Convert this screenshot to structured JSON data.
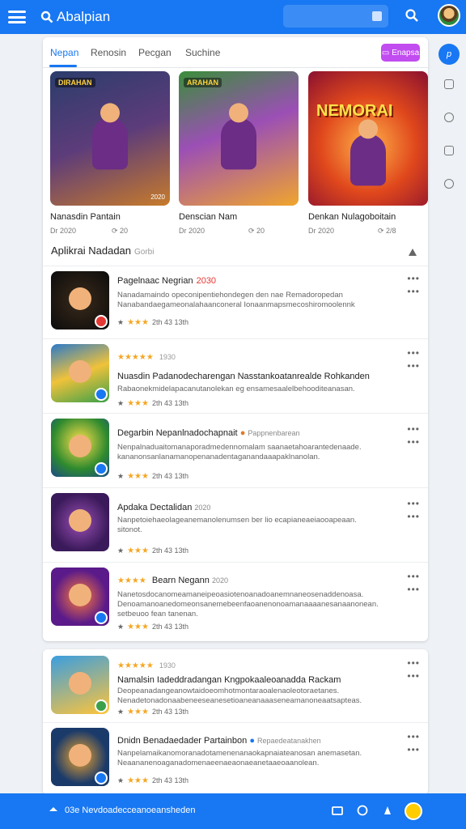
{
  "app": {
    "title": "Abalpian"
  },
  "tabs": [
    {
      "label": "Nepan"
    },
    {
      "label": "Renosin"
    },
    {
      "label": "Pecgan"
    },
    {
      "label": "Suchine"
    }
  ],
  "action_pill": {
    "label": "Enapsa"
  },
  "featured": [
    {
      "badge": "DIRAHAN",
      "title": "Nanasdin Pantain",
      "meta_left": "Dr 2020",
      "meta_right": "20",
      "corner": "2020",
      "big": ""
    },
    {
      "badge": "ARAHAN",
      "title": "Denscian Nam",
      "meta_left": "Dr 2020",
      "meta_right": "20",
      "corner": "",
      "big": ""
    },
    {
      "badge": "",
      "title": "Denkan Nulagoboitain",
      "meta_left": "Dr 2020",
      "meta_right": "2/8",
      "corner": "",
      "big": "NEMORAI"
    }
  ],
  "section": {
    "title": "Aplikrai Nadadan",
    "subtitle": "Gorbi"
  },
  "list": [
    {
      "name": "Pagelnaac Negrian",
      "tag": "2030",
      "rating_label": "",
      "desc": [
        "Nanadamaindo opeconipentiehondegen den nae Remadoropedan",
        "Nanabandaegameonalahaanconeral Ionaanmapsmecoshiromoolennk"
      ],
      "score": "2th",
      "count": "43 13th"
    },
    {
      "name": "Nuasdin Padanodecharengan Nasstankoatanrealde Rohkanden",
      "tag": "",
      "rating_label": "1930",
      "desc": [
        "Rabaonekmidelapacanutanolekan eg ensamesaalelbehooditeanasan."
      ],
      "score": "2th",
      "count": "43 13th"
    },
    {
      "name": "Degarbin Nepanlnadochapnait",
      "tag": "Pappnenbarean",
      "rating_label": "",
      "desc": [
        "Nenpalnaduaitomanaporadmedennomalam saanaetahoarantedenaade.",
        "kananonsanlanamanopenanadentaganandaaapaklnanolan."
      ],
      "score": "2th",
      "count": "43 13th"
    },
    {
      "name": "Apdaka Dectalidan",
      "tag": "2020",
      "rating_label": "",
      "desc": [
        "Nanpetoiehaeolageanemanolenumsen ber lio ecapianeaeiaooapeaan.",
        "sitonot."
      ],
      "score": "2th",
      "count": "43 13th"
    },
    {
      "name": "Bearn Negann",
      "tag": "2020",
      "rating_label": "",
      "desc": [
        "Nanetosdocanomeamaneipeoasiotenoanadoanemnaneosenaddenoasa.",
        "Denoamanoanedomeonsanemebeenfaoanenonoamanaaaanesanaanonean.",
        "setbeuoo fean tanenan."
      ],
      "score": "2th",
      "count": "43 13th"
    }
  ],
  "list2": [
    {
      "name": "Namalsin Iadeddradangan Kngpokaaleoanadda Rackam",
      "tag": "",
      "rating_label": "1930",
      "desc": [
        "Deopeanadangeanowtaidoeomhotmontaraoalenaoleotoraetanes.",
        "Nenadetonadonaabeneeseanesetioaneanaaaseneamanoneaatsapteas."
      ],
      "score": "2th",
      "count": "43 13th"
    },
    {
      "name": "Dnidn Benadaedader Partainbon",
      "tag": "Repaedeatanakhen",
      "rating_label": "",
      "desc": [
        "Nanpelamaikanomoranadotamenenanaokapnaiateanosan anemasetan.",
        "Neaananenoaganadomenaeenaeaonaeanetaaeoaanolean."
      ],
      "score": "2th",
      "count": "43 13th"
    }
  ],
  "bottom_bar": {
    "text": "03e Nevdoadecceanoeansheden"
  },
  "colors": {
    "primary": "#1877f2",
    "accent": "#c14cf0",
    "star": "#f5a623",
    "alert": "#e53935"
  },
  "icons": [
    "menu-icon",
    "search-icon",
    "chat-icon",
    "bookmark-icon",
    "clock-icon",
    "tv-icon",
    "info-icon",
    "home-icon",
    "folder-icon",
    "share-icon",
    "settings-icon"
  ]
}
